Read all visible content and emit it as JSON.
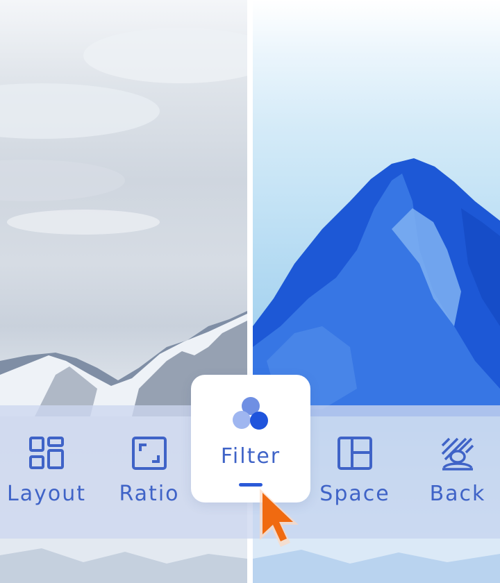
{
  "toolbar": {
    "items": [
      {
        "label": "Layout",
        "icon": "layout-grid-icon"
      },
      {
        "label": "Ratio",
        "icon": "aspect-ratio-icon"
      },
      {
        "label": "Filter",
        "icon": "filter-circles-icon",
        "active": true
      },
      {
        "label": "Space",
        "icon": "split-panel-icon"
      },
      {
        "label": "Back",
        "icon": "background-person-icon"
      }
    ]
  },
  "colors": {
    "accent": "#2b5ad8",
    "label": "#3f63c7",
    "toolbar_bg": "#cdd7f0",
    "cursor": "#f06a10"
  }
}
